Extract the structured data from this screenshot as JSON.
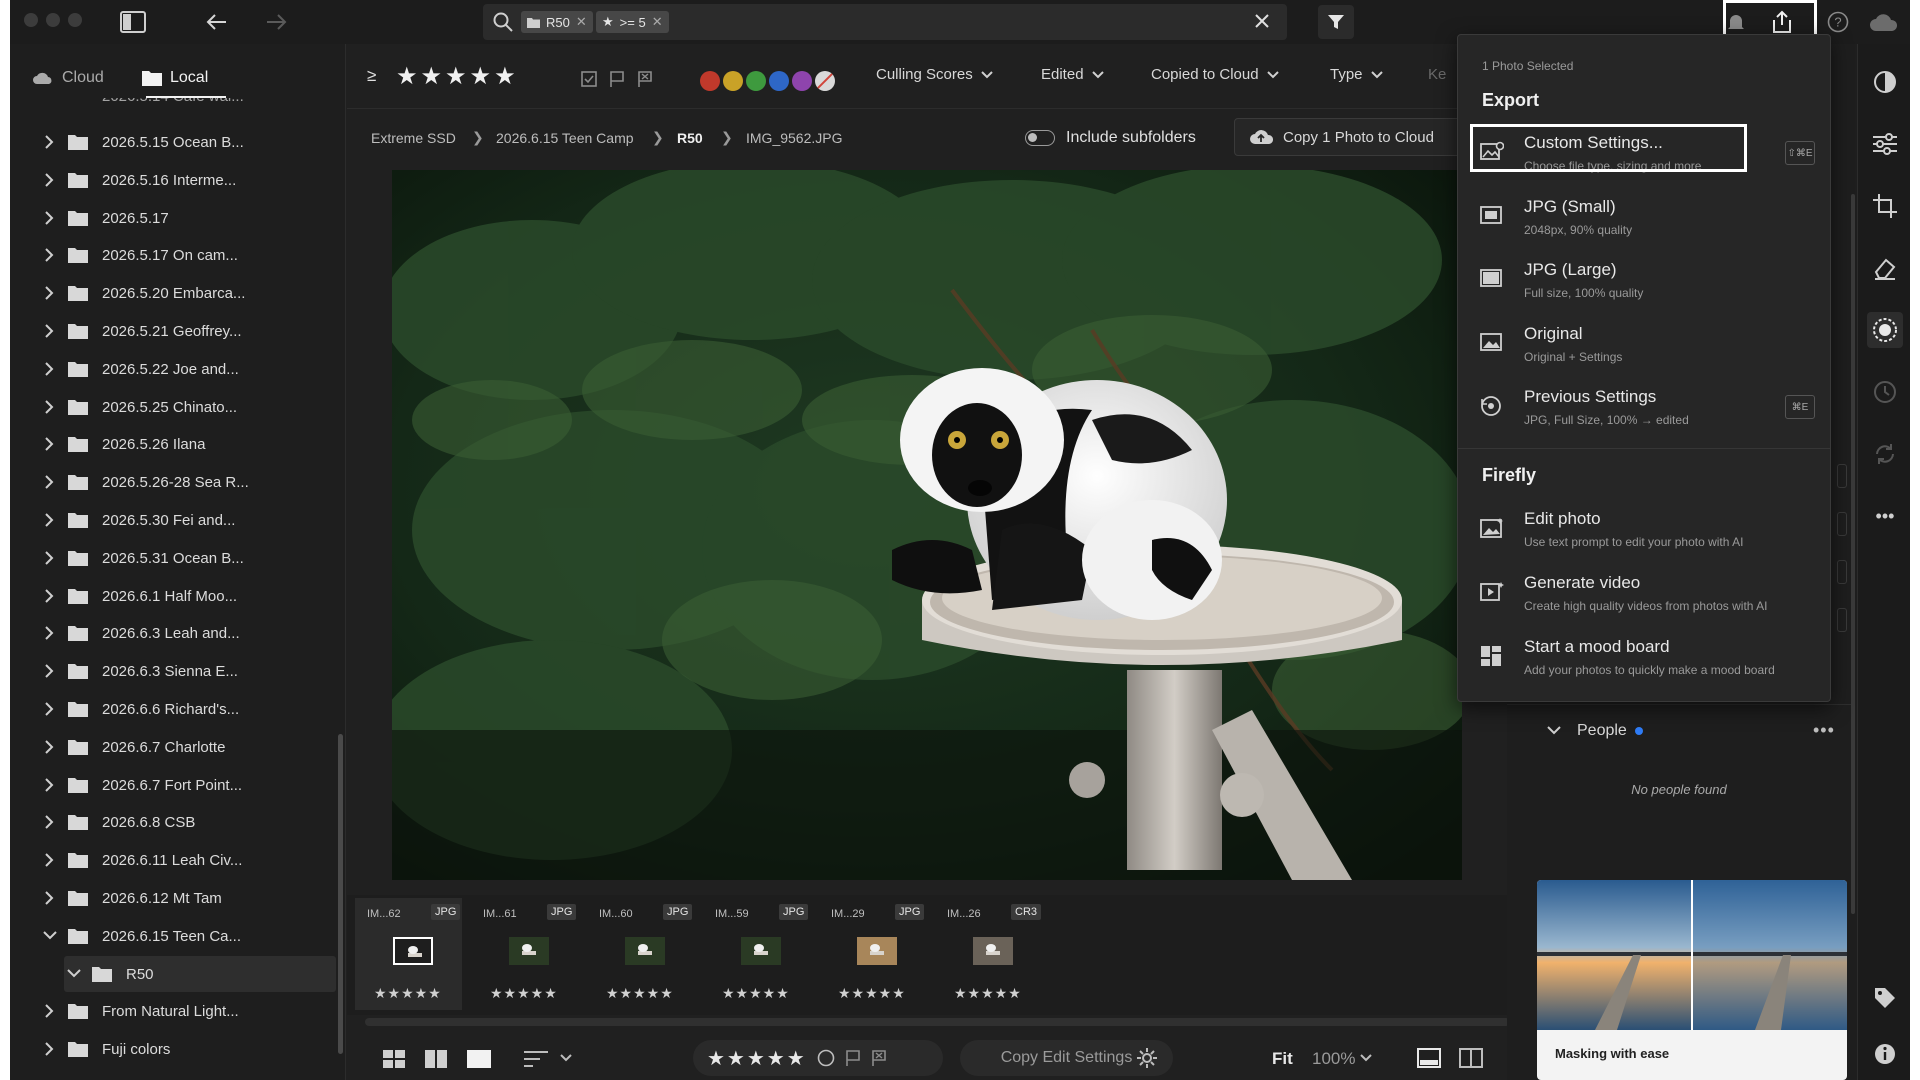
{
  "topbar": {
    "search_chips": [
      {
        "icon": "folder-icon",
        "label": "R50"
      },
      {
        "icon": "star-icon",
        "label": ">= 5"
      }
    ]
  },
  "left": {
    "tabs": [
      {
        "icon": "cloud-icon",
        "label": "Cloud"
      },
      {
        "icon": "folder-icon",
        "label": "Local"
      }
    ],
    "folders": [
      {
        "label": "2026.5.15 Ocean B...",
        "expanded": false
      },
      {
        "label": "2026.5.16 Interme...",
        "expanded": false
      },
      {
        "label": "2026.5.17",
        "expanded": false
      },
      {
        "label": "2026.5.17 On cam...",
        "expanded": false
      },
      {
        "label": "2026.5.20 Embarca...",
        "expanded": false
      },
      {
        "label": "2026.5.21 Geoffrey...",
        "expanded": false
      },
      {
        "label": "2026.5.22 Joe and...",
        "expanded": false
      },
      {
        "label": "2026.5.25 Chinato...",
        "expanded": false
      },
      {
        "label": "2026.5.26 Ilana",
        "expanded": false
      },
      {
        "label": "2026.5.26-28 Sea R...",
        "expanded": false
      },
      {
        "label": "2026.5.30 Fei and...",
        "expanded": false
      },
      {
        "label": "2026.5.31 Ocean B...",
        "expanded": false
      },
      {
        "label": "2026.6.1 Half Moo...",
        "expanded": false
      },
      {
        "label": "2026.6.3 Leah and...",
        "expanded": false
      },
      {
        "label": "2026.6.3 Sienna E...",
        "expanded": false
      },
      {
        "label": "2026.6.6 Richard's...",
        "expanded": false
      },
      {
        "label": "2026.6.7 Charlotte",
        "expanded": false
      },
      {
        "label": "2026.6.7 Fort Point...",
        "expanded": false
      },
      {
        "label": "2026.6.8 CSB",
        "expanded": false
      },
      {
        "label": "2026.6.11 Leah Civ...",
        "expanded": false
      },
      {
        "label": "2026.6.12 Mt Tam",
        "expanded": false
      },
      {
        "label": "2026.6.15 Teen Ca...",
        "expanded": true
      },
      {
        "label": "R50",
        "expanded": true,
        "child": true,
        "selected": true
      },
      {
        "label": "From Natural Light...",
        "expanded": false
      },
      {
        "label": "Fuji colors",
        "expanded": false
      }
    ]
  },
  "filters": {
    "rating_prefix": "≥",
    "culling": "Culling Scores",
    "edited": "Edited",
    "copied": "Copied to Cloud",
    "type": "Type",
    "more": "Ke",
    "color_labels": [
      "#c0392b",
      "#c9a227",
      "#3e9a3e",
      "#2e67c7",
      "#8e44ad"
    ]
  },
  "breadcrumb": [
    "Extreme SSD",
    "2026.6.15 Teen Camp",
    "R50",
    "IMG_9562.JPG"
  ],
  "subfolders": {
    "label": "Include subfolders"
  },
  "copy_cloud": {
    "label": "Copy 1 Photo to Cloud"
  },
  "filmstrip": [
    {
      "name": "IM...62",
      "type": "JPG",
      "stars": "★★★★★",
      "selected": true
    },
    {
      "name": "IM...61",
      "type": "JPG",
      "stars": "★★★★★"
    },
    {
      "name": "IM...60",
      "type": "JPG",
      "stars": "★★★★★"
    },
    {
      "name": "IM...59",
      "type": "JPG",
      "stars": "★★★★★"
    },
    {
      "name": "IM...29",
      "type": "JPG",
      "stars": "★★★★★"
    },
    {
      "name": "IM...26",
      "type": "CR3",
      "stars": "★★★★★"
    }
  ],
  "bottombar": {
    "copy_edit": "Copy Edit Settings",
    "fit": "Fit",
    "zoom": "100%"
  },
  "export_menu": {
    "selected_count": "1 Photo Selected",
    "export_heading": "Export",
    "export_items": [
      {
        "title": "Custom Settings...",
        "sub": "Choose file type, sizing and more",
        "icon": "custom-export-icon",
        "kbd": "⇧⌘E"
      },
      {
        "title": "JPG (Small)",
        "sub": "2048px, 90% quality",
        "icon": "jpg-small-icon"
      },
      {
        "title": "JPG (Large)",
        "sub": "Full size, 100% quality",
        "icon": "jpg-large-icon"
      },
      {
        "title": "Original",
        "sub": "Original + Settings",
        "icon": "original-icon"
      },
      {
        "title": "Previous Settings",
        "sub": "JPG, Full Size, 100% → edited",
        "icon": "previous-settings-icon",
        "kbd": "⌘E"
      }
    ],
    "firefly_heading": "Firefly",
    "firefly_items": [
      {
        "title": "Edit photo",
        "sub": "Use text prompt to edit your photo with AI",
        "icon": "edit-photo-icon"
      },
      {
        "title": "Generate video",
        "sub": "Create high quality videos from photos with AI",
        "icon": "generate-video-icon"
      },
      {
        "title": "Start a mood board",
        "sub": "Add your photos to quickly make a mood board",
        "icon": "mood-board-icon"
      }
    ]
  },
  "right": {
    "people_label": "People",
    "no_people": "No people found",
    "promo_caption": "Masking with ease"
  }
}
